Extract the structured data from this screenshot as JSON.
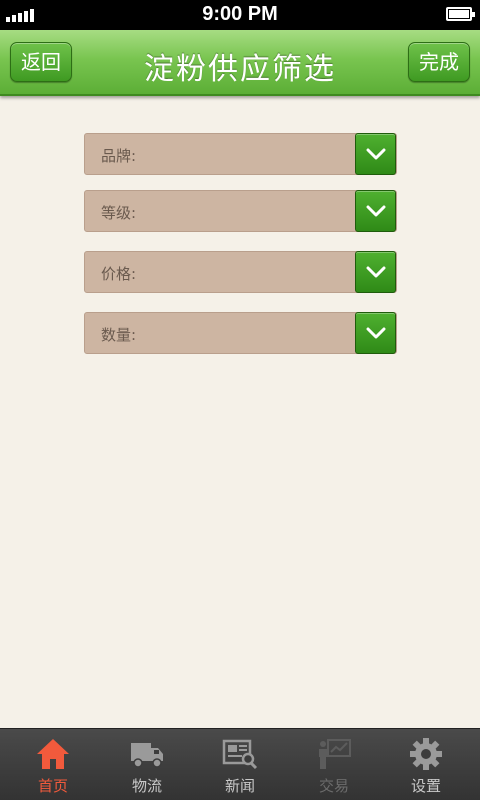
{
  "status_bar": {
    "time": "9:00 PM"
  },
  "nav": {
    "title": "淀粉供应筛选",
    "back_label": "返回",
    "done_label": "完成"
  },
  "filters": [
    {
      "label": "品牌:"
    },
    {
      "label": "等级:"
    },
    {
      "label": "价格:"
    },
    {
      "label": "数量:"
    }
  ],
  "tabs": [
    {
      "label": "首页",
      "icon": "home-icon",
      "active": true
    },
    {
      "label": "物流",
      "icon": "truck-icon",
      "active": false
    },
    {
      "label": "新闻",
      "icon": "newspaper-icon",
      "active": false
    },
    {
      "label": "交易",
      "icon": "chart-icon",
      "active": false
    },
    {
      "label": "设置",
      "icon": "gear-icon",
      "active": false
    }
  ],
  "colors": {
    "nav_green": "#79c550",
    "background": "#f5f1e8",
    "field_fill": "#cdb5a2",
    "active_tab": "#f25a3c"
  }
}
